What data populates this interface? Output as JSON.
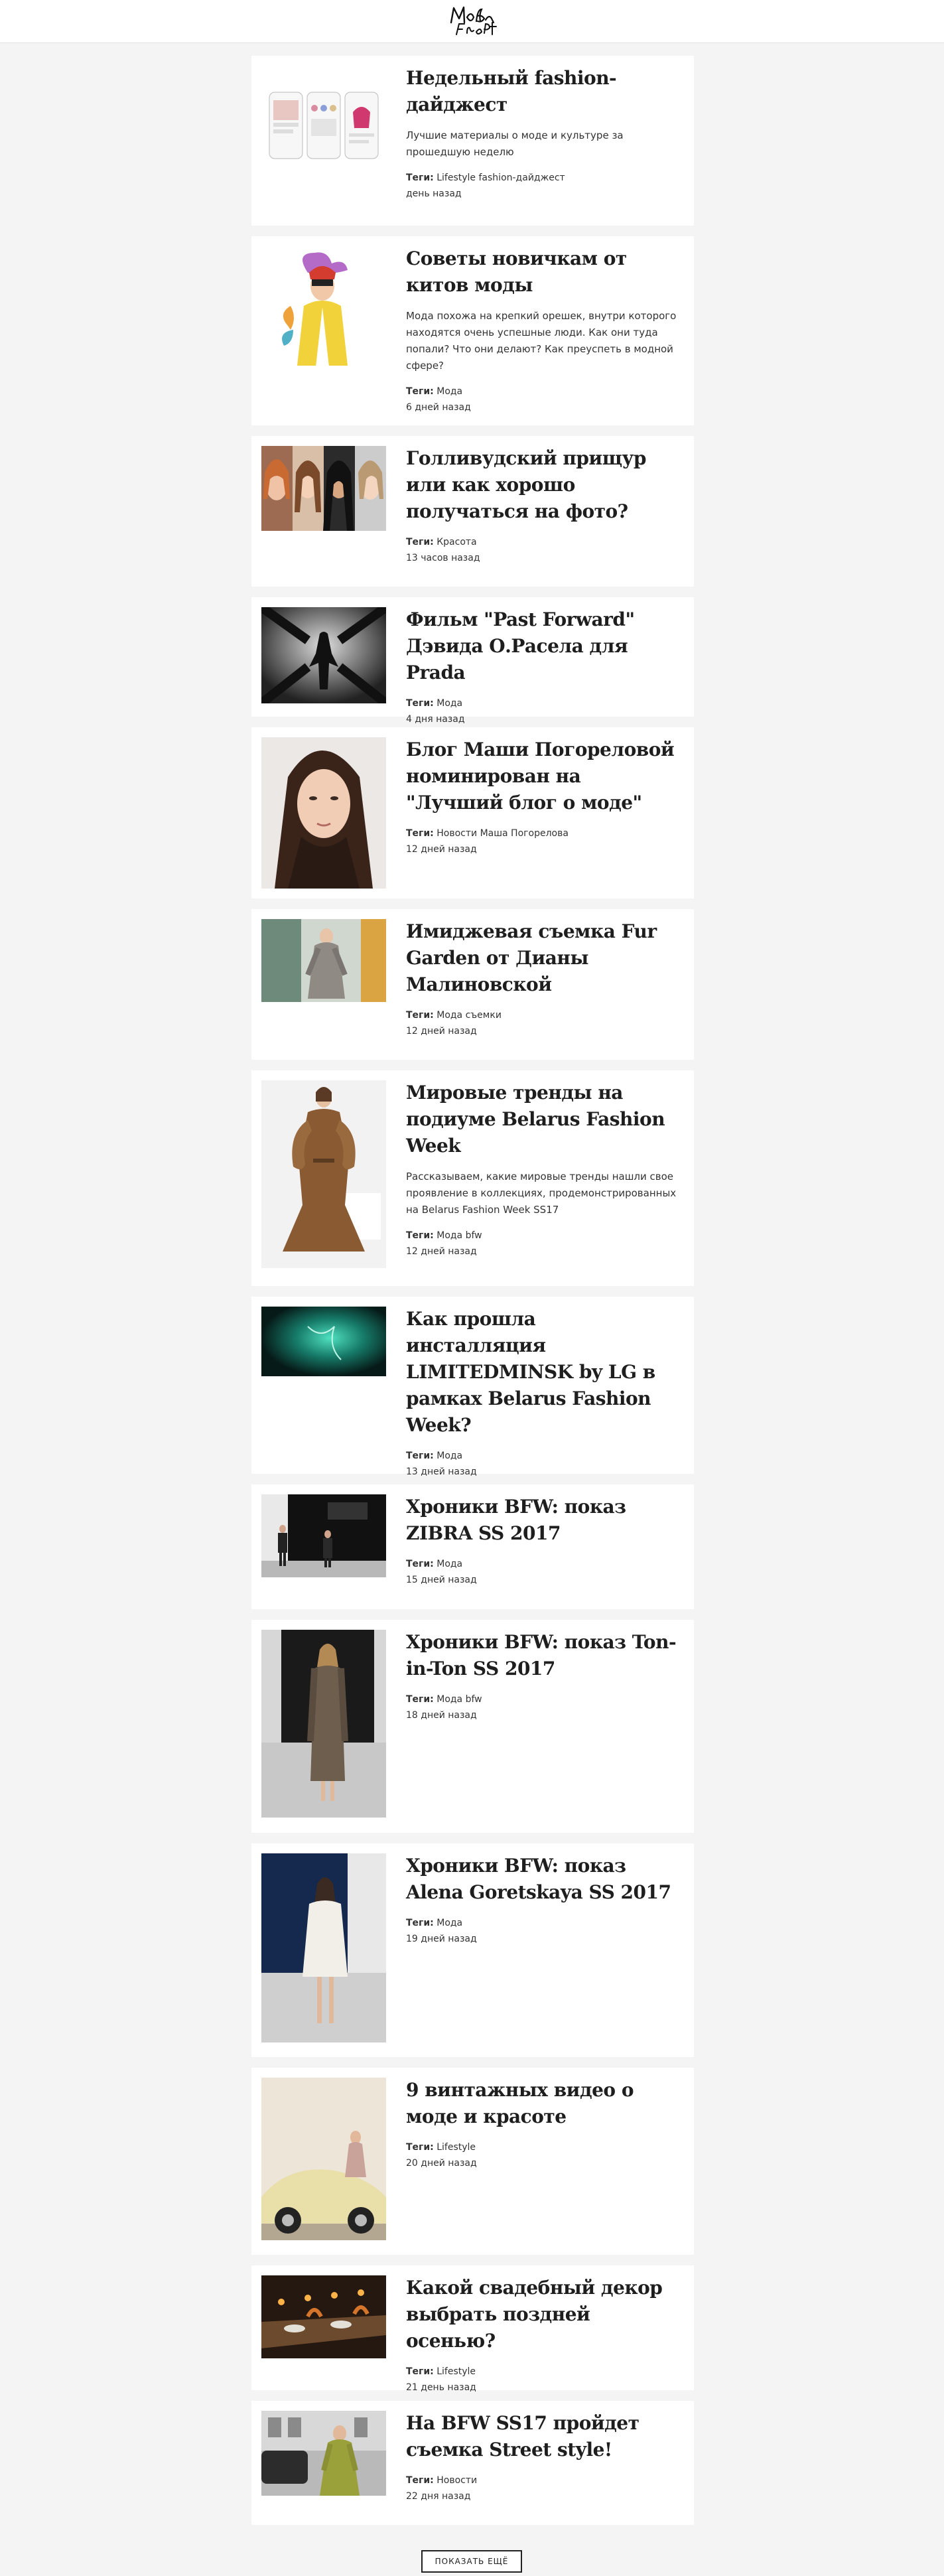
{
  "header": {
    "logo_text": "Мода Flash"
  },
  "articles": [
    {
      "title": "Недельный fashion-дайджест",
      "desc": "Лучшие материалы о моде и культуре за прошедшую неделю",
      "tags_label": "Теги:",
      "tags": [
        "Lifestyle",
        "fashion-дайджест"
      ],
      "date": "день назад"
    },
    {
      "title": "Советы новичкам от китов моды",
      "desc": "Мода похожа на крепкий орешек, внутри которого находятся очень успешные люди. Как они туда попали? Что они делают? Как преуспеть в модной сфере?",
      "tags_label": "Теги:",
      "tags": [
        "Мода"
      ],
      "date": "6 дней назад"
    },
    {
      "title": "Голливудский прищур или как хорошо получаться на фото?",
      "desc": "",
      "tags_label": "Теги:",
      "tags": [
        "Красота"
      ],
      "date": "13 часов назад"
    },
    {
      "title": "Фильм \"Past Forward\" Дэвида О.Расела для Prada",
      "desc": "",
      "tags_label": "Теги:",
      "tags": [
        "Мода"
      ],
      "date": "4 дня назад"
    },
    {
      "title": "Блог Маши Погореловой номинирован на \"Лучший блог о моде\"",
      "desc": "",
      "tags_label": "Теги:",
      "tags": [
        "Новости",
        "Маша Погорелова"
      ],
      "date": "12 дней назад"
    },
    {
      "title": "Имиджевая съемка Fur Garden от Дианы Малиновской",
      "desc": "",
      "tags_label": "Теги:",
      "tags": [
        "Мода",
        "съемки"
      ],
      "date": "12 дней назад"
    },
    {
      "title": "Мировые тренды на подиуме Belarus Fashion Week",
      "desc": "Рассказываем, какие мировые тренды нашли свое проявление в коллекциях, продемонстрированных на Belarus Fashion Week SS17",
      "tags_label": "Теги:",
      "tags": [
        "Мода",
        "bfw"
      ],
      "date": "12 дней назад"
    },
    {
      "title": "Как прошла инсталляция LIMITEDMINSK by LG в рамках Belarus Fashion Week?",
      "desc": "",
      "tags_label": "Теги:",
      "tags": [
        "Мода"
      ],
      "date": "13 дней назад"
    },
    {
      "title": "Хроники BFW: показ ZIBRA SS 2017",
      "desc": "",
      "tags_label": "Теги:",
      "tags": [
        "Мода"
      ],
      "date": "15 дней назад"
    },
    {
      "title": "Хроники BFW: показ Ton-in-Ton SS 2017",
      "desc": "",
      "tags_label": "Теги:",
      "tags": [
        "Мода",
        "bfw"
      ],
      "date": "18 дней назад"
    },
    {
      "title": "Хроники BFW: показ Alena Goretskaya SS 2017",
      "desc": "",
      "tags_label": "Теги:",
      "tags": [
        "Мода"
      ],
      "date": "19 дней назад"
    },
    {
      "title": "9 винтажных видео о моде и красоте",
      "desc": "",
      "tags_label": "Теги:",
      "tags": [
        "Lifestyle"
      ],
      "date": "20 дней назад"
    },
    {
      "title": "Какой свадебный декор выбрать поздней осенью?",
      "desc": "",
      "tags_label": "Теги:",
      "tags": [
        "Lifestyle"
      ],
      "date": "21 день назад"
    },
    {
      "title": "На BFW SS17 пройдет съемка Street style!",
      "desc": "",
      "tags_label": "Теги:",
      "tags": [
        "Новости"
      ],
      "date": "22 дня назад"
    }
  ],
  "load_more": "ПОКАЗАТЬ ЕЩЁ"
}
